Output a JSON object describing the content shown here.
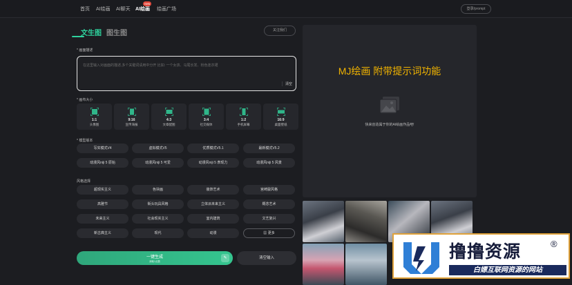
{
  "nav": {
    "items": [
      "首页",
      "AI绘画",
      "AI聊天",
      "AI绘画",
      "绘画广场"
    ],
    "badge": "new",
    "login": "登录/prompt"
  },
  "tabs": {
    "active": "文生图",
    "inactive": "图生图"
  },
  "follow_btn": "关注我们",
  "prompt": {
    "label": "* 画面描述",
    "placeholder": "在这里输入对画面的描述,多个关键词请用中分开 比如: 一个女孩、马尾长发、粉色连衣裙",
    "clear": "清空"
  },
  "size": {
    "label": "* 画布大小",
    "options": [
      {
        "ratio": "1:1",
        "name": "头像图"
      },
      {
        "ratio": "9:16",
        "name": "宣传海报"
      },
      {
        "ratio": "4:3",
        "name": "文章配图"
      },
      {
        "ratio": "3:4",
        "name": "社交媒体"
      },
      {
        "ratio": "1:2",
        "name": "手机屏幕"
      },
      {
        "ratio": "16:9",
        "name": "桌面壁纸"
      }
    ]
  },
  "model": {
    "label": "* 模型版本",
    "options": [
      "写实模式V4",
      "虚拟模式V5",
      "优质模式V5.1",
      "最新模式V5.2",
      "动漫风niji 5 原始",
      "动漫风niji 5 可爱",
      "动漫风niji 5 表现力",
      "动漫风niji 5 风景"
    ]
  },
  "style": {
    "label": "风格选择",
    "options": [
      "超现实主义",
      "色块画",
      "装饰艺术",
      "宫崎骏风格",
      "高雅节",
      "街头玩具风格",
      "立体派未来主义",
      "概念艺术",
      "未来主义",
      "社会现实主义",
      "室内建筑",
      "文艺复兴",
      "新古典主义",
      "现代",
      "动漫"
    ],
    "more": "更多"
  },
  "generate": {
    "label": "一键生成",
    "sub": "消耗1点数"
  },
  "clear_input": "清空输入",
  "preview": {
    "title": "MJ绘画 附带提示词功能",
    "text": "快来创造属于你的AI绘画作品吧!"
  },
  "watermark": {
    "title": "撸撸资源",
    "reg": "®",
    "subtitle": "白嫖互联网资源的网站"
  }
}
